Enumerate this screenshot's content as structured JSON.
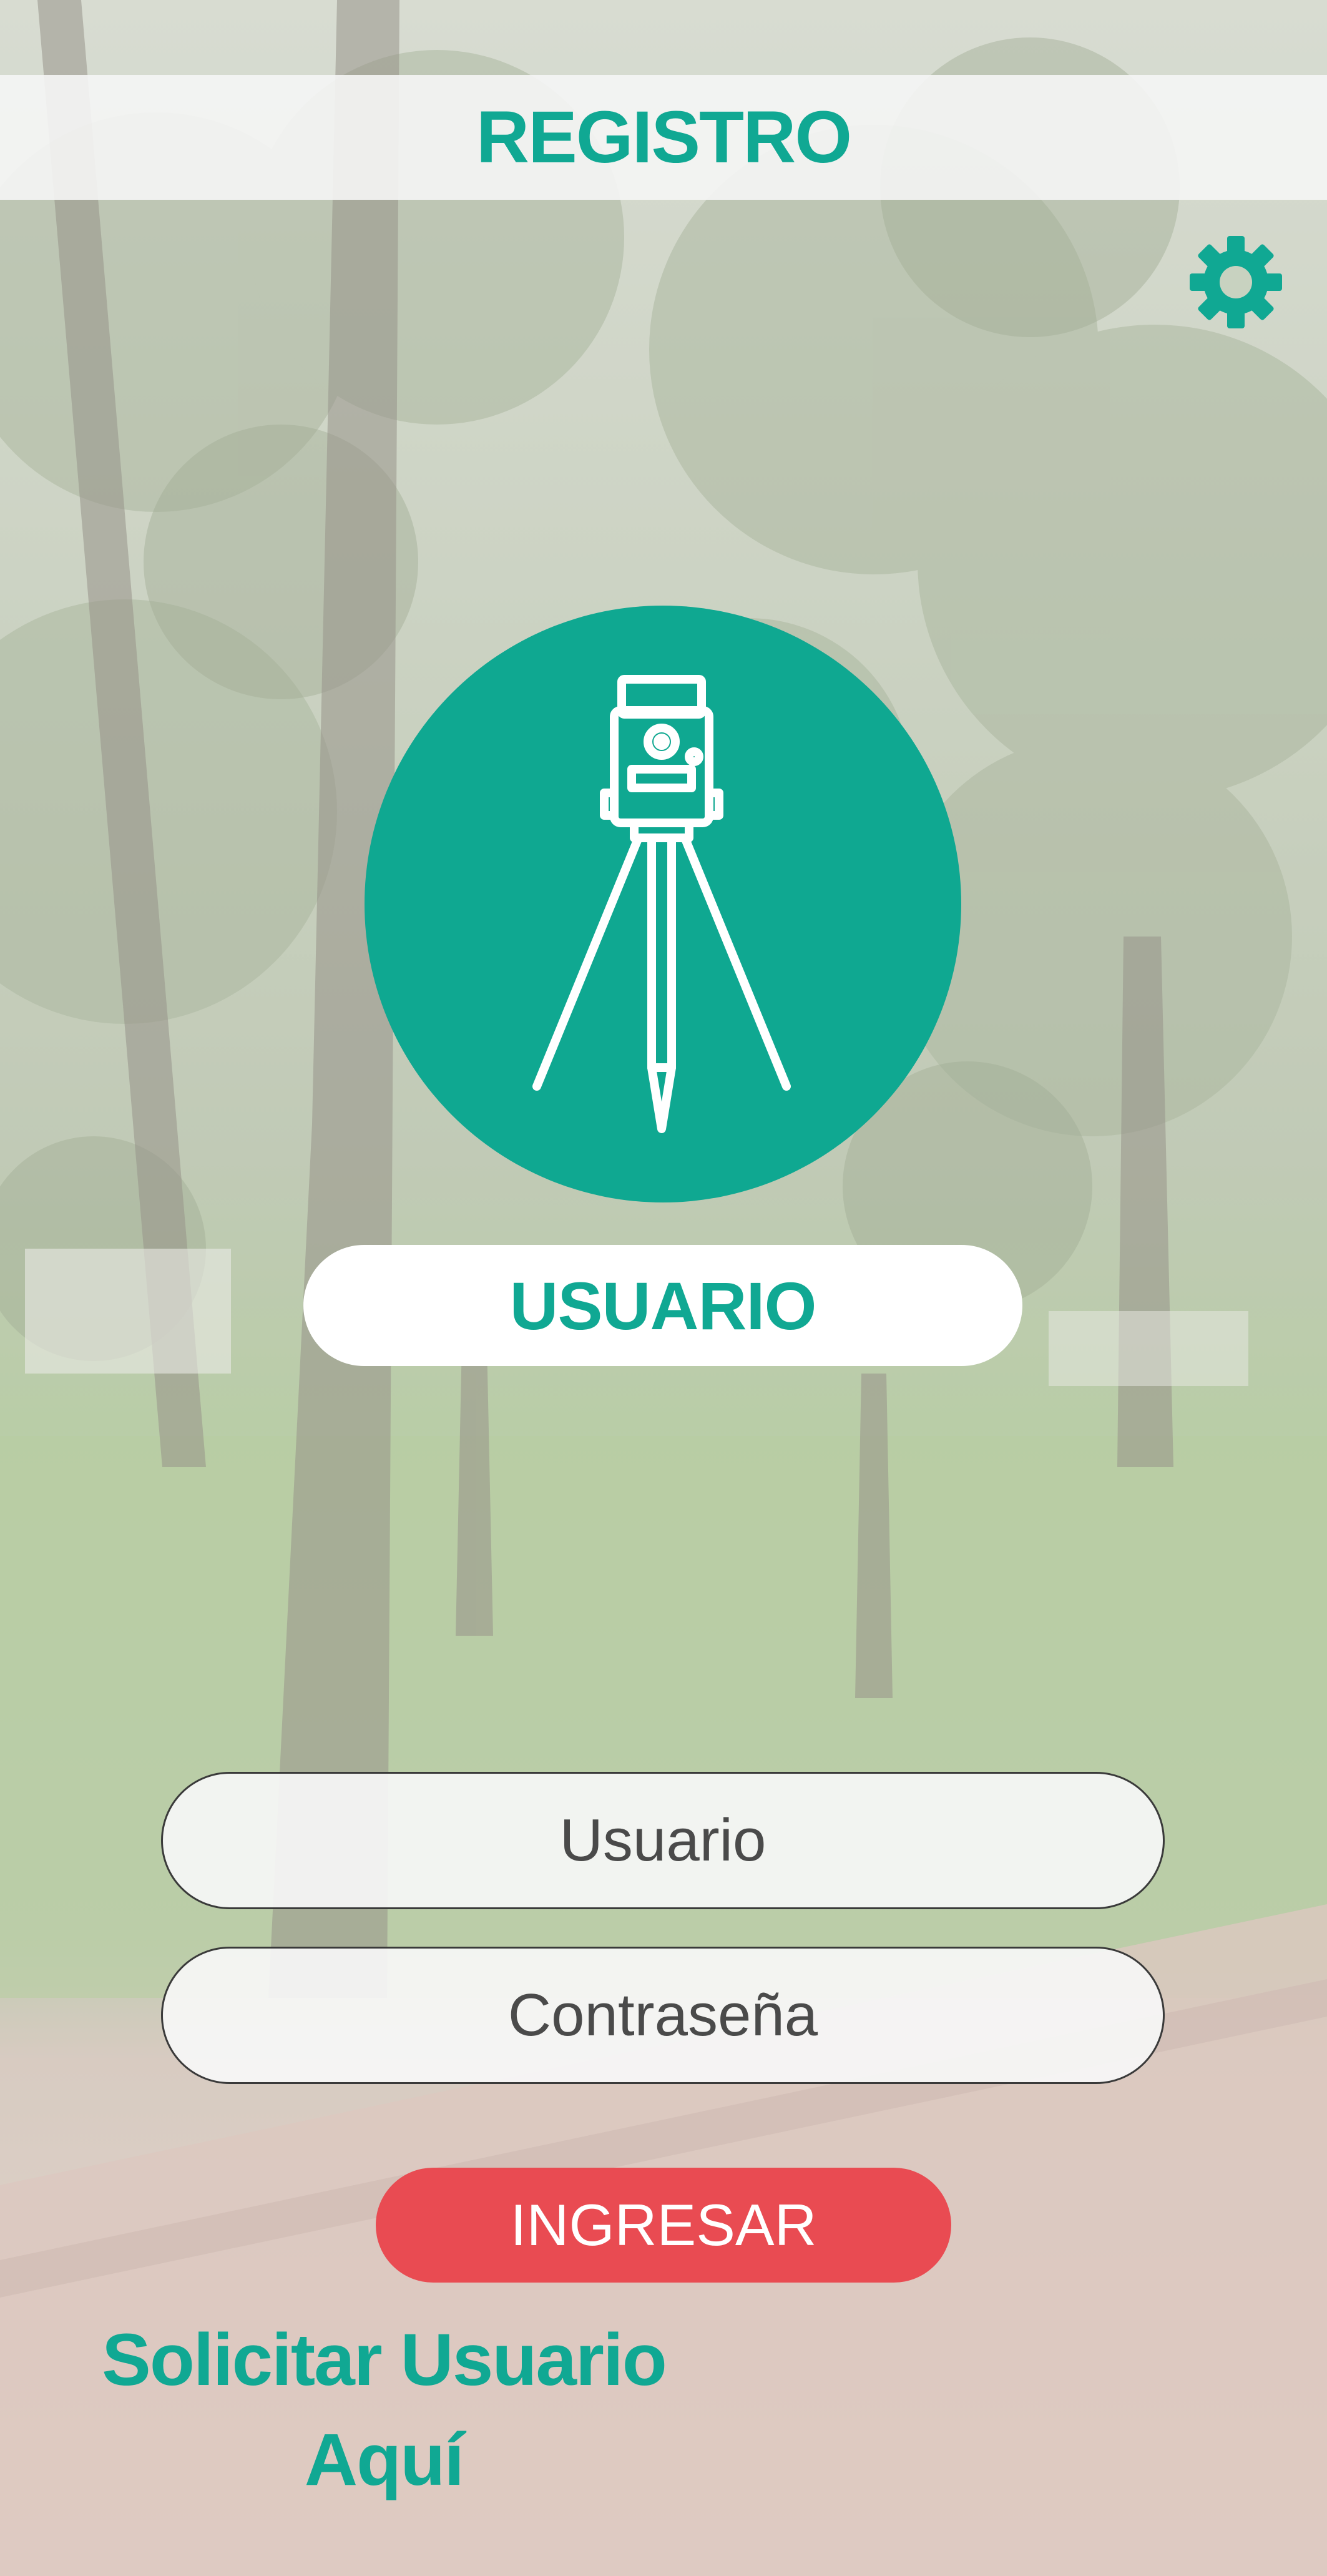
{
  "header": {
    "title": "REGISTRO"
  },
  "icons": {
    "settings": "gear-icon",
    "logo": "surveying-tripod-icon"
  },
  "user_badge": {
    "label": "USUARIO"
  },
  "form": {
    "username_placeholder": "Usuario",
    "password_placeholder": "Contraseña",
    "submit_label": "INGRESAR"
  },
  "footer_link": {
    "line1": "Solicitar Usuario",
    "line2": "Aquí"
  },
  "colors": {
    "brand_teal": "#10a893",
    "button_red": "#e94b52",
    "pill_white": "#ffffff"
  }
}
